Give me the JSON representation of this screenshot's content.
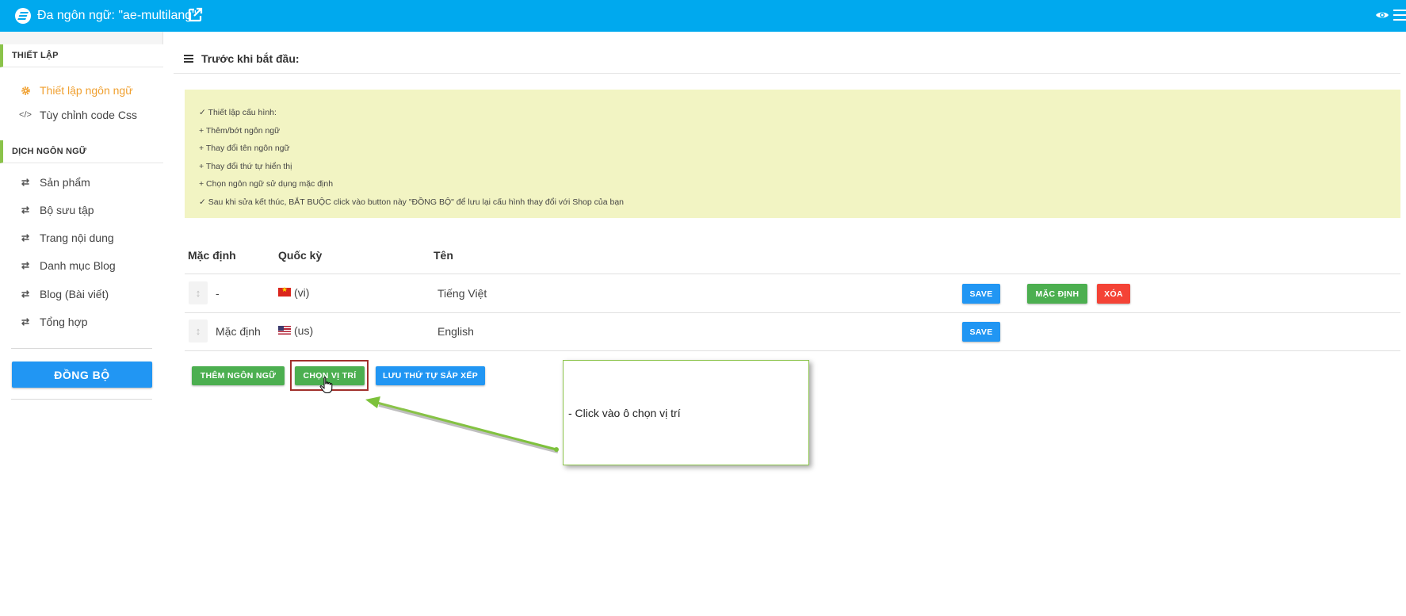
{
  "topbar": {
    "title": "Đa ngôn ngữ: \"ae-multilang\"",
    "icons": [
      "app-logo-icon",
      "external-link-icon",
      "eye-icon",
      "menu-icon"
    ],
    "bg_color": "#00a9ee"
  },
  "sidebar": {
    "section1": "THIẾT LẬP",
    "items1": [
      {
        "label": "Thiết lập ngôn ngữ",
        "icon": "gear-icon",
        "active": true
      },
      {
        "label": "Tùy chỉnh code Css",
        "icon": "code-icon",
        "active": false
      }
    ],
    "section2": "DỊCH NGÔN NGỮ",
    "items2": [
      {
        "label": "Sản phẩm",
        "icon": "swap-icon"
      },
      {
        "label": "Bộ sưu tập",
        "icon": "swap-icon"
      },
      {
        "label": "Trang nội dung",
        "icon": "swap-icon"
      },
      {
        "label": "Danh mục Blog",
        "icon": "swap-icon"
      },
      {
        "label": "Blog (Bài viết)",
        "icon": "swap-icon"
      },
      {
        "label": "Tổng hợp",
        "icon": "swap-icon"
      }
    ],
    "sync_button": "ĐỒNG BỘ"
  },
  "main": {
    "heading": "Trước khi bắt đầu:",
    "notice": [
      "✓ Thiết lập cấu hình:",
      "+ Thêm/bớt ngôn ngữ",
      "+ Thay đổi tên ngôn ngữ",
      "+ Thay đổi thứ tự hiển thị",
      "+ Chọn ngôn ngữ sử dụng mặc định",
      "✓ Sau khi sửa kết thúc, BẮT BUỘC click vào button này \"ĐỒNG BỘ\" để lưu lại cấu hình thay đổi với Shop của bạn"
    ],
    "table": {
      "headers": [
        "Mặc định",
        "Quốc kỳ",
        "Tên"
      ],
      "rows": [
        {
          "default": "-",
          "flag": "(vi)",
          "name": "Tiếng Việt",
          "save": "SAVE",
          "set_default": "MẶC ĐỊNH",
          "delete": "XÓA"
        },
        {
          "default": "Mặc định",
          "flag": "(us)",
          "name": "English",
          "save": "SAVE"
        }
      ]
    },
    "actions": {
      "add_language": "THÊM NGÔN NGỮ",
      "choose_position": "CHỌN VỊ TRÍ",
      "save_order": "LƯU THỨ TỰ SẮP XẾP"
    },
    "callout": "- Click vào ô chọn vị trí"
  },
  "colors": {
    "accent_green": "#8bc34a",
    "button_blue": "#2196f3",
    "button_green": "#4caf50",
    "button_red": "#f44336",
    "notice_bg": "#f2f4c3",
    "active_orange": "#f0a030"
  }
}
